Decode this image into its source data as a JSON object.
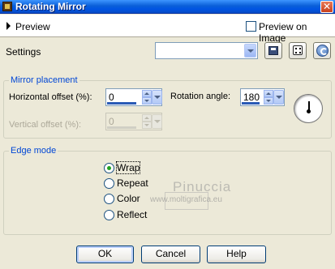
{
  "window": {
    "title": "Rotating Mirror",
    "close_glyph": "✕"
  },
  "preview": {
    "label": "Preview",
    "preview_on_image_label": "Preview on Image",
    "preview_on_image_checked": false
  },
  "settings": {
    "label": "Settings",
    "preset_value": "",
    "icons": [
      "save-preset-icon",
      "randomize-icon",
      "reset-icon"
    ]
  },
  "mirror_placement": {
    "title": "Mirror placement",
    "horizontal_offset": {
      "label": "Horizontal offset (%):",
      "value": "0"
    },
    "vertical_offset": {
      "label": "Vertical offset (%):",
      "value": "0",
      "disabled": true
    },
    "rotation_angle": {
      "label": "Rotation angle:",
      "value": "180"
    }
  },
  "edge_mode": {
    "title": "Edge mode",
    "options": [
      {
        "label": "Wrap",
        "checked": true
      },
      {
        "label": "Repeat",
        "checked": false
      },
      {
        "label": "Color",
        "checked": false
      },
      {
        "label": "Reflect",
        "checked": false
      }
    ]
  },
  "watermark": {
    "title": "Pinuccia",
    "url": "www.moltigrafica.eu"
  },
  "buttons": {
    "ok": "OK",
    "cancel": "Cancel",
    "help": "Help"
  },
  "colors": {
    "title_bar": "#0054e3",
    "group_title": "#0046d5",
    "dialog_bg": "#ece9d8"
  }
}
